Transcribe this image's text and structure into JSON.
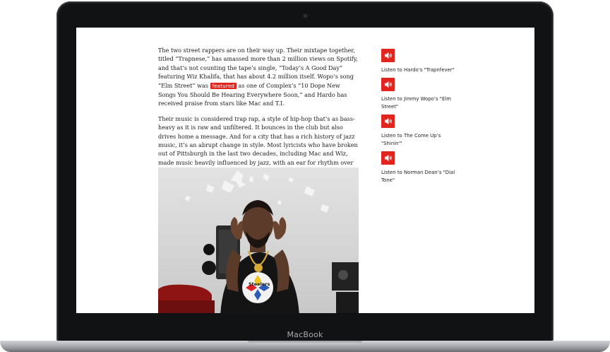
{
  "device": {
    "brand": "MacBook"
  },
  "article": {
    "paragraph1": {
      "before": "The two street rappers are on their way up. Their mixtape together, titled “Trapnese,” has amassed more than 2 million views on Spotify, and that’s not counting the tape’s single, “Today’s A Good Day” featuring Wiz Khalifa, that has about 4.2 million itself. Wopo’s song “Elm Street” was",
      "highlight": "featured",
      "after": "as one of Complex’s “10 Dope New Songs You Should Be Hearing Everywhere Soon,” and Hardo has received praise from stars like Mac and T.I."
    },
    "paragraph2": "Their music is considered trap rap, a style of hip-hop that’s as bass-heavy as it is raw and unfiltered. It bounces in the club but also drives home a message. And for a city that has a rich history of jazz music, it’s an abrupt change in style. Most lyricists who have broken out of Pittsburgh in the last two decades, including Mac and Wiz, made music heavily influenced by jazz, with an ear for rhythm over noise — or, as Franchise from local rap group The Come-Up describes it, “rapping street music, but rapping it over horns.”",
    "photo": {
      "shirt_text": "Steelers"
    }
  },
  "sidebar": {
    "items": [
      {
        "label": "Listen to Hardo’s \"Trapnfever\"",
        "icon": "speaker-icon"
      },
      {
        "label": "Listen to Jimmy Wopo’s \"Elm Street\"",
        "icon": "speaker-icon"
      },
      {
        "label": "Listen to The Come Up’s \"Shinin'\"",
        "icon": "speaker-icon"
      },
      {
        "label": "Listen to Norman Dean’s \"Dial Tone\"",
        "icon": "speaker-icon"
      }
    ]
  },
  "colors": {
    "accent": "#e2241f",
    "bezel": "#111214"
  }
}
